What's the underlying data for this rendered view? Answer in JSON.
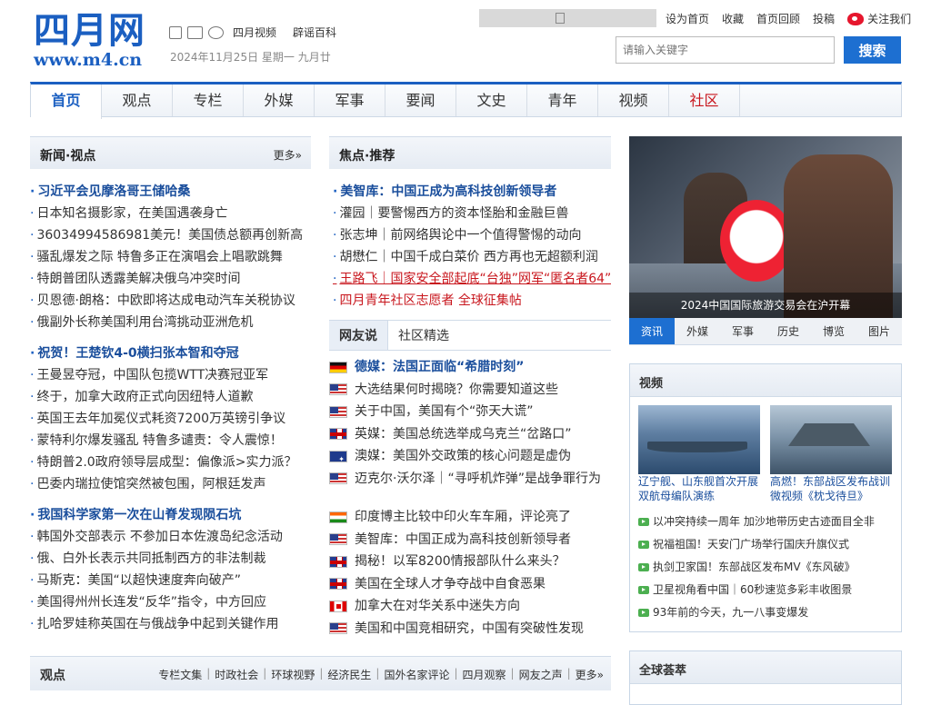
{
  "header": {
    "logo_cn": "四月网",
    "logo_url": "www.m4.cn",
    "icon_links": [
      "四月视频",
      "辟谣百科"
    ],
    "date": "2024年11月25日 星期一 九月廿",
    "top_links": [
      "设为首页",
      "收藏",
      "首页回顾",
      "投稿"
    ],
    "weibo_label": "关注我们",
    "search_placeholder": "请输入关键字",
    "search_button": "搜索"
  },
  "nav": {
    "items": [
      "首页",
      "观点",
      "专栏",
      "外媒",
      "军事",
      "要闻",
      "文史",
      "青年",
      "视频",
      "社区"
    ]
  },
  "news": {
    "title": "新闻·视点",
    "more": "更多»",
    "items": [
      "习近平会见摩洛哥王储哈桑",
      "日本知名摄影家，在美国遇袭身亡",
      "36034994586981美元！美国债总额再创新高",
      "骚乱爆发之际 特鲁多正在演唱会上唱歌跳舞",
      "特朗普团队透露美解决俄乌冲突时间",
      "贝恩德·朗格：中欧即将达成电动汽车关税协议",
      "俄副外长称美国利用台湾挑动亚洲危机",
      "祝贺！王楚钦4-0横扫张本智和夺冠",
      "王曼昱夺冠，中国队包揽WTT决赛冠亚军",
      "终于，加拿大政府正式向因纽特人道歉",
      "英国王去年加冕仪式耗资7200万英镑引争议",
      "蒙特利尔爆发骚乱 特鲁多谴责：令人震惊！",
      "特朗普2.0政府领导层成型：偏像派>实力派？",
      "巴委内瑞拉使馆突然被包围，阿根廷发声",
      "我国科学家第一次在山脊发现陨石坑",
      "韩国外交部表示 不参加日本佐渡岛纪念活动",
      "俄、白外长表示共同抵制西方的非法制裁",
      "马斯克：美国“以超快速度奔向破产”",
      "美国得州州长连发“反华”指令，中方回应",
      "扎哈罗娃称英国在与俄战争中起到关键作用"
    ]
  },
  "focus": {
    "title": "焦点·推荐",
    "items": [
      "美智库：中国正成为高科技创新领导者",
      "灌园｜要警惕西方的资本怪胎和金融巨兽",
      "张志坤｜前网络舆论中一个值得警惕的动向",
      "胡懋仁｜中国千成白菜价 西方再也无超额利润",
      "王路飞｜国家安全部起底“台独”网军“匿名者64”",
      "四月青年社区志愿者 全球征集帖"
    ]
  },
  "netizen": {
    "tabs": [
      "网友说",
      "社区精选"
    ],
    "items": [
      {
        "flag": "de",
        "text": "德媒：法国正面临“希腊时刻”"
      },
      {
        "flag": "us",
        "text": "大选结果何时揭晓？你需要知道这些"
      },
      {
        "flag": "us",
        "text": "关于中国，美国有个“弥天大谎”"
      },
      {
        "flag": "uk",
        "text": "英媒：美国总统选举成乌克兰“岔路口”"
      },
      {
        "flag": "au",
        "text": "澳媒：美国外交政策的核心问题是虚伪"
      },
      {
        "flag": "us",
        "text": "迈克尔·沃尔泽｜“寻呼机炸弹”是战争罪行为"
      },
      {
        "flag": "in",
        "text": "印度博主比较中印火车车厢，评论亮了"
      },
      {
        "flag": "us",
        "text": "美智库：中国正成为高科技创新领导者"
      },
      {
        "flag": "uk",
        "text": "揭秘！以军8200情报部队什么来头？"
      },
      {
        "flag": "uk",
        "text": "美国在全球人才争夺战中自食恶果"
      },
      {
        "flag": "ca",
        "text": "加拿大在对华关系中迷失方向"
      },
      {
        "flag": "us",
        "text": "美国和中国竞相研究，中国有突破性发现"
      }
    ]
  },
  "photo": {
    "caption": "2024中国国际旅游交易会在沪开幕",
    "tabs": [
      "资讯",
      "外媒",
      "军事",
      "历史",
      "博览",
      "图片"
    ]
  },
  "video": {
    "title": "视频",
    "thumbs": [
      {
        "caption": "辽宁舰、山东舰首次开展双航母编队演练"
      },
      {
        "caption": "高燃！东部战区发布战训微视频《枕戈待旦》"
      }
    ],
    "items": [
      "以冲突持续一周年 加沙地带历史古迹面目全非",
      "祝福祖国！天安门广场举行国庆升旗仪式",
      "执剑卫家国！东部战区发布MV《东风破》",
      "卫星视角看中国｜60秒速览多彩丰收图景",
      "93年前的今天，九一八事变爆发"
    ]
  },
  "global": {
    "title": "全球荟萃"
  },
  "opinion": {
    "title": "观点",
    "links": [
      "专栏文集",
      "时政社会",
      "环球视野",
      "经济民生",
      "国外名家评论",
      "四月观察",
      "网友之声",
      "更多»"
    ]
  },
  "colors": {
    "brand": "#1b5fc1",
    "accent_red": "#c8161d",
    "button": "#1d6fd1"
  }
}
